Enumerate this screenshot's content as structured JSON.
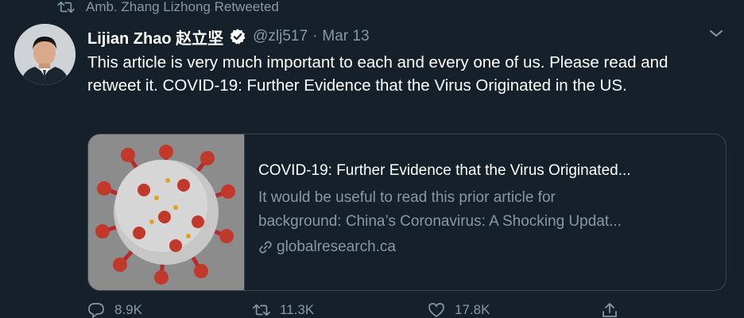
{
  "retweet": {
    "label": "Amb. Zhang Lizhong Retweeted"
  },
  "author": {
    "display_name": "Lijian Zhao 赵立坚",
    "handle": "@zlj517",
    "separator": "·",
    "date": "Mar 13"
  },
  "tweet": {
    "text": "This article is very much important to each and every one of us. Please read and retweet it. COVID-19: Further Evidence that the Virus Originated in the US."
  },
  "card": {
    "title": "COVID-19: Further Evidence that the Virus Originated...",
    "description_line1": "It would be useful to read this prior article for",
    "description_line2": "background: China’s Coronavirus: A Shocking Updat...",
    "domain": "globalresearch.ca"
  },
  "actions": {
    "replies": "8.9K",
    "retweets": "11.3K",
    "likes": "17.8K"
  },
  "colors": {
    "background": "#15202b",
    "secondary_text": "#8899a6",
    "border": "#38444d",
    "verified": "#ffffff"
  }
}
